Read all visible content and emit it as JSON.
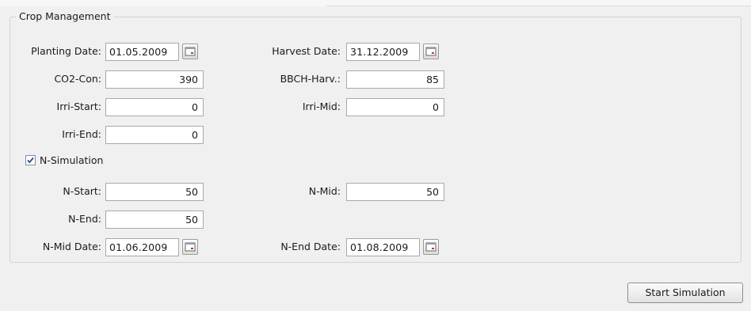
{
  "group": {
    "title": "Crop Management"
  },
  "fields": {
    "planting_date": {
      "label": "Planting Date:",
      "value": "01.05.2009"
    },
    "harvest_date": {
      "label": "Harvest Date:",
      "value": "31.12.2009"
    },
    "co2_con": {
      "label": "CO2-Con:",
      "value": "390"
    },
    "bbch_harv": {
      "label": "BBCH-Harv.:",
      "value": "85"
    },
    "irri_start": {
      "label": "Irri-Start:",
      "value": "0"
    },
    "irri_mid": {
      "label": "Irri-Mid:",
      "value": "0"
    },
    "irri_end": {
      "label": "Irri-End:",
      "value": "0"
    },
    "n_start": {
      "label": "N-Start:",
      "value": "50"
    },
    "n_mid": {
      "label": "N-Mid:",
      "value": "50"
    },
    "n_end": {
      "label": "N-End:",
      "value": "50"
    },
    "n_mid_date": {
      "label": "N-Mid Date:",
      "value": "01.06.2009"
    },
    "n_end_date": {
      "label": "N-End Date:",
      "value": "01.08.2009"
    }
  },
  "n_simulation": {
    "label": "N-Simulation",
    "checked": true
  },
  "buttons": {
    "start_simulation": "Start Simulation"
  },
  "colors": {
    "check_mark": "#2d4e8a",
    "calendar_accent": "#c0392b"
  },
  "icons": {
    "calendar": "calendar-icon",
    "check": "checkmark-icon"
  }
}
